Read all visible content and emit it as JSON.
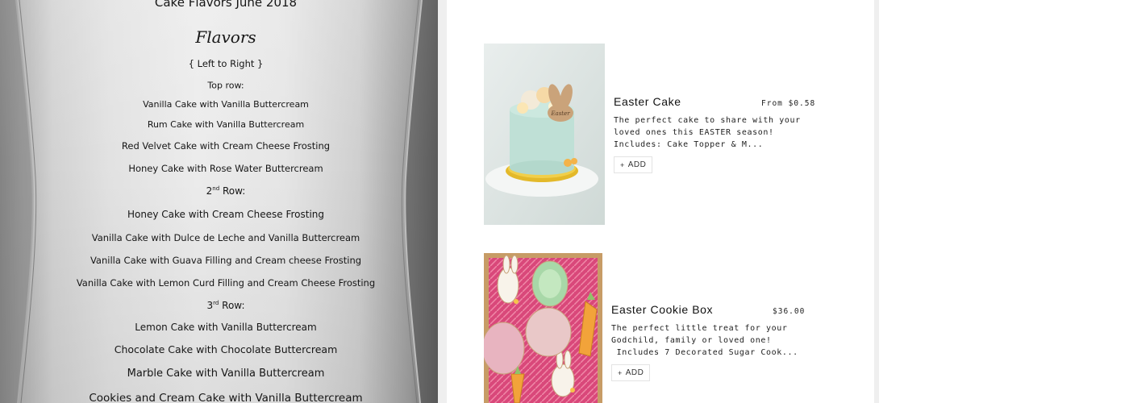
{
  "menu_photo": {
    "title": "Cake Flavors June 2018",
    "heading": "Flavors",
    "order_note": "{ Left to Right }",
    "rows": [
      {
        "label_num": "Top",
        "label_sup": "",
        "label_rest": " row:",
        "items": [
          "Vanilla Cake with Vanilla Buttercream",
          "Rum Cake with Vanilla Buttercream",
          "Red Velvet Cake with Cream Cheese Frosting",
          "Honey Cake with Rose Water Buttercream"
        ]
      },
      {
        "label_num": "2",
        "label_sup": "nd",
        "label_rest": " Row:",
        "items": [
          "Honey Cake with Cream Cheese Frosting",
          "Vanilla Cake with Dulce de Leche and Vanilla Buttercream",
          "Vanilla Cake with Guava Filling and Cream cheese Frosting",
          "Vanilla Cake with Lemon Curd Filling and Cream Cheese Frosting"
        ]
      },
      {
        "label_num": "3",
        "label_sup": "rd",
        "label_rest": " Row:",
        "items": [
          "Lemon Cake with Vanilla Buttercream",
          "Chocolate Cake with Chocolate Buttercream",
          "Marble Cake with Vanilla Buttercream",
          "Cookies and Cream Cake with Vanilla Buttercream"
        ]
      }
    ]
  },
  "products": [
    {
      "name": "Easter Cake",
      "price": "From $0.58",
      "description": "The perfect cake to share with your\nloved ones this EASTER season!\nIncludes: Cake Topper & M...",
      "add_label": "ADD",
      "image_icon": "easter-cake-photo",
      "topper_text": "Easter"
    },
    {
      "name": "Easter Cookie Box",
      "price": "$36.00",
      "description": "The perfect little treat for your\nGodchild, family or loved one!\n Includes 7 Decorated Sugar Cook...",
      "add_label": "ADD",
      "image_icon": "easter-cookie-box-photo"
    }
  ],
  "colors": {
    "strip": "#efefef",
    "cake_frosting": "#bfe0d6",
    "gold_board": "#e3b92a",
    "cookie_pink": "#e8b4c0",
    "carrot_orange": "#f2a33a"
  }
}
